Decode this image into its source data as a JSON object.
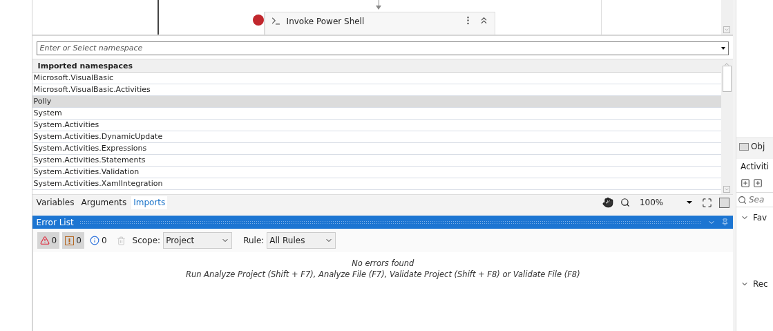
{
  "canvas": {
    "activity": {
      "title": "Invoke Power Shell",
      "breakpoint": true
    }
  },
  "namespace_field": {
    "placeholder": "Enter or Select namespace"
  },
  "imports_grid": {
    "header": "Imported namespaces",
    "rows": [
      {
        "name": "Microsoft.VisualBasic",
        "selected": false
      },
      {
        "name": "Microsoft.VisualBasic.Activities",
        "selected": false
      },
      {
        "name": "Polly",
        "selected": true
      },
      {
        "name": "System",
        "selected": false
      },
      {
        "name": "System.Activities",
        "selected": false
      },
      {
        "name": "System.Activities.DynamicUpdate",
        "selected": false
      },
      {
        "name": "System.Activities.Expressions",
        "selected": false
      },
      {
        "name": "System.Activities.Statements",
        "selected": false
      },
      {
        "name": "System.Activities.Validation",
        "selected": false
      },
      {
        "name": "System.Activities.XamlIntegration",
        "selected": false
      }
    ]
  },
  "bottom_tabs": [
    {
      "label": "Variables",
      "selected": false
    },
    {
      "label": "Arguments",
      "selected": false
    },
    {
      "label": "Imports",
      "selected": true
    }
  ],
  "zoom": {
    "value": "100%"
  },
  "error_list": {
    "title": "Error List",
    "filters": [
      {
        "kind": "error",
        "count": "0",
        "on": true
      },
      {
        "kind": "warning",
        "count": "0",
        "on": true
      },
      {
        "kind": "info",
        "count": "0",
        "on": false
      }
    ],
    "scope_label": "Scope:",
    "scope_value": "Project",
    "rule_label": "Rule:",
    "rule_value": "All Rules",
    "message": "No errors found",
    "hint": "Run Analyze Project (Shift + F7), Analyze File (F7), Validate Project (Shift + F8) or Validate File (F8)"
  },
  "side_panel": {
    "object_tab": "Obj",
    "activities_title": "Activiti",
    "search_placeholder": "Sea",
    "sections": [
      "Fav",
      "Rec"
    ]
  }
}
